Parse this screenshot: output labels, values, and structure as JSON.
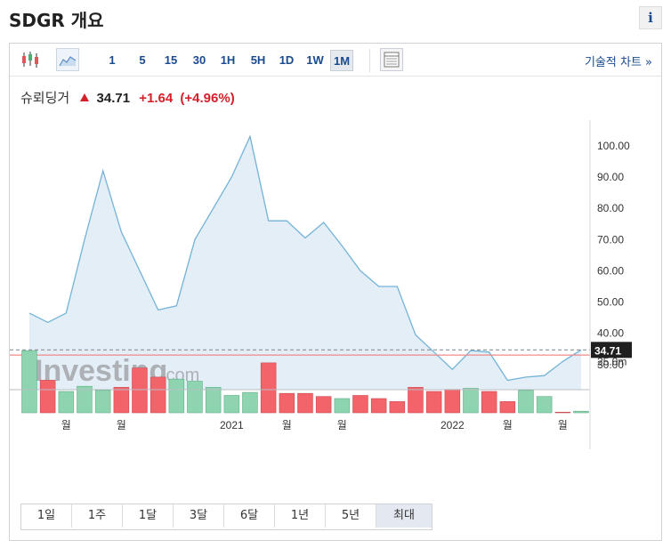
{
  "page": {
    "title": "SDGR 개요",
    "info_label": "i"
  },
  "toolbar": {
    "intervals": [
      "1",
      "5",
      "15",
      "30",
      "1H",
      "5H",
      "1D",
      "1W",
      "1M"
    ],
    "active_interval": "1M",
    "tech_link": "기술적 차트 »"
  },
  "quote": {
    "name": "슈뢰딩거",
    "price": "34.71",
    "change": "+1.64",
    "change_pct": "(+4.96%)"
  },
  "ranges": [
    "1일",
    "1주",
    "1달",
    "3달",
    "6달",
    "1년",
    "5년",
    "최대"
  ],
  "active_range": "최대",
  "watermark": {
    "main": "Investing",
    "suffix": ".com"
  },
  "colors": {
    "line": "#74b3d8",
    "area": "#e3eef7",
    "up": "#8fd4b0",
    "down": "#f2646a",
    "current": "#f08a8a",
    "accent": "#1a4a8f"
  },
  "chart_data": {
    "type": "area",
    "price_series": [
      46.5,
      43.5,
      46.5,
      70,
      92,
      72.5,
      60,
      47.5,
      48.8,
      70,
      80,
      90,
      103,
      76,
      76,
      70.5,
      75.5,
      68,
      60,
      55,
      55,
      39.5,
      34,
      28.5,
      34.5,
      34,
      25,
      26,
      26.5,
      31,
      34.71
    ],
    "volume_series": [
      {
        "v": 30.5,
        "up": true
      },
      {
        "v": 16,
        "up": false
      },
      {
        "v": 10.5,
        "up": true
      },
      {
        "v": 13,
        "up": true
      },
      {
        "v": 11,
        "up": true
      },
      {
        "v": 12.5,
        "up": false
      },
      {
        "v": 22,
        "up": false
      },
      {
        "v": 17.5,
        "up": false
      },
      {
        "v": 16.5,
        "up": true
      },
      {
        "v": 15.5,
        "up": true
      },
      {
        "v": 12.5,
        "up": true
      },
      {
        "v": 8.5,
        "up": true
      },
      {
        "v": 10,
        "up": true
      },
      {
        "v": 24.5,
        "up": false
      },
      {
        "v": 9.5,
        "up": false
      },
      {
        "v": 9.5,
        "up": false
      },
      {
        "v": 8,
        "up": false
      },
      {
        "v": 7,
        "up": true
      },
      {
        "v": 8.5,
        "up": false
      },
      {
        "v": 7,
        "up": false
      },
      {
        "v": 5.5,
        "up": false
      },
      {
        "v": 12.5,
        "up": false
      },
      {
        "v": 10.5,
        "up": false
      },
      {
        "v": 11.5,
        "up": false
      },
      {
        "v": 12,
        "up": true
      },
      {
        "v": 10.5,
        "up": false
      },
      {
        "v": 5.5,
        "up": false
      },
      {
        "v": 11,
        "up": true
      },
      {
        "v": 8,
        "up": true
      },
      {
        "v": 0.3,
        "up": false
      },
      {
        "v": 0.8,
        "up": true
      }
    ],
    "price_ylim": [
      22,
      106.5
    ],
    "volume_ylim": [
      0,
      46
    ],
    "y_ticks": [
      "100.00",
      "90.00",
      "80.00",
      "70.00",
      "60.00",
      "50.00",
      "40.00",
      "30.00"
    ],
    "y_tick_values": [
      100,
      90,
      80,
      70,
      60,
      50,
      40,
      30
    ],
    "volume_tick": {
      "label": "25.0m",
      "value": 25
    },
    "x_labels": [
      {
        "label": "월",
        "i": 2
      },
      {
        "label": "월",
        "i": 5
      },
      {
        "label": "2021",
        "i": 11
      },
      {
        "label": "월",
        "i": 14
      },
      {
        "label": "월",
        "i": 17
      },
      {
        "label": "2022",
        "i": 23
      },
      {
        "label": "월",
        "i": 26
      },
      {
        "label": "월",
        "i": 29
      }
    ],
    "current_price": 34.71,
    "reference_price": 33.07,
    "current_label": "34.71",
    "grid": false
  }
}
